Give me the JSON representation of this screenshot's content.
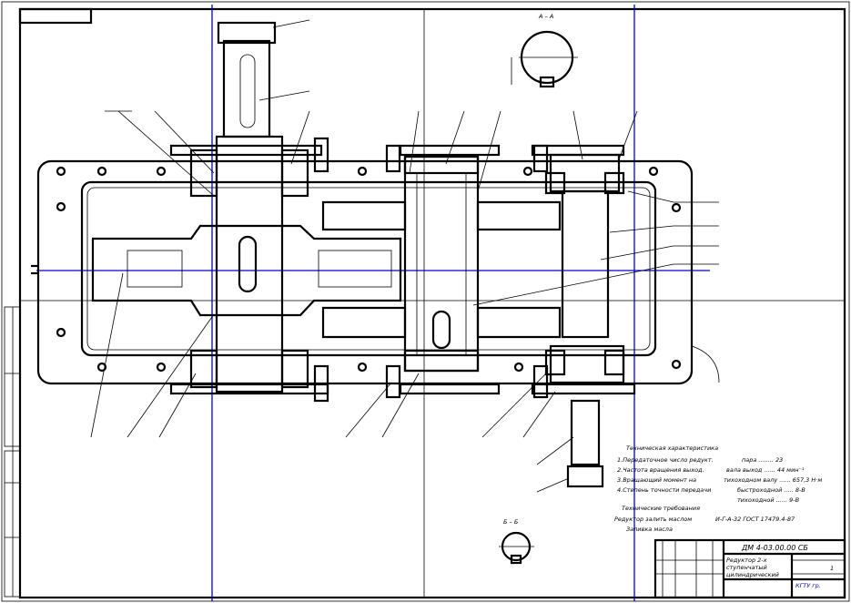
{
  "drawing": {
    "section_a_label": "А – А",
    "section_b_label": "Б – Б",
    "tech_spec": {
      "title": "Техническая характеристика",
      "lines": [
        "1.Передаточное число редукт.",
        "2.Частота вращения выход.",
        "3.Вращающий момент на",
        "4.Степень точности передачи"
      ],
      "values": [
        "пара ........ 23",
        "вала выход ...... 44 мин⁻¹",
        "тихоходном валу ...... 657,3 Н·м",
        "быстроходной ..... 8-В",
        "тихоходной ...... 9-В"
      ]
    },
    "tech_req": {
      "title": "Технические требования",
      "lines": [
        "Редуктор залить маслом",
        "Заливка масла"
      ],
      "standard": "И-Г-А-32 ГОСТ 17479.4-87"
    },
    "title_block": {
      "designation": "ДМ 4-03.00.00 СБ",
      "name_lines": [
        "Редуктор 2-х",
        "ступенчатый",
        "цилиндрический"
      ],
      "sheet": "1",
      "org": "КГТУ гр."
    },
    "colors": {
      "lines": "#000000",
      "axes": "#0000d0"
    }
  }
}
